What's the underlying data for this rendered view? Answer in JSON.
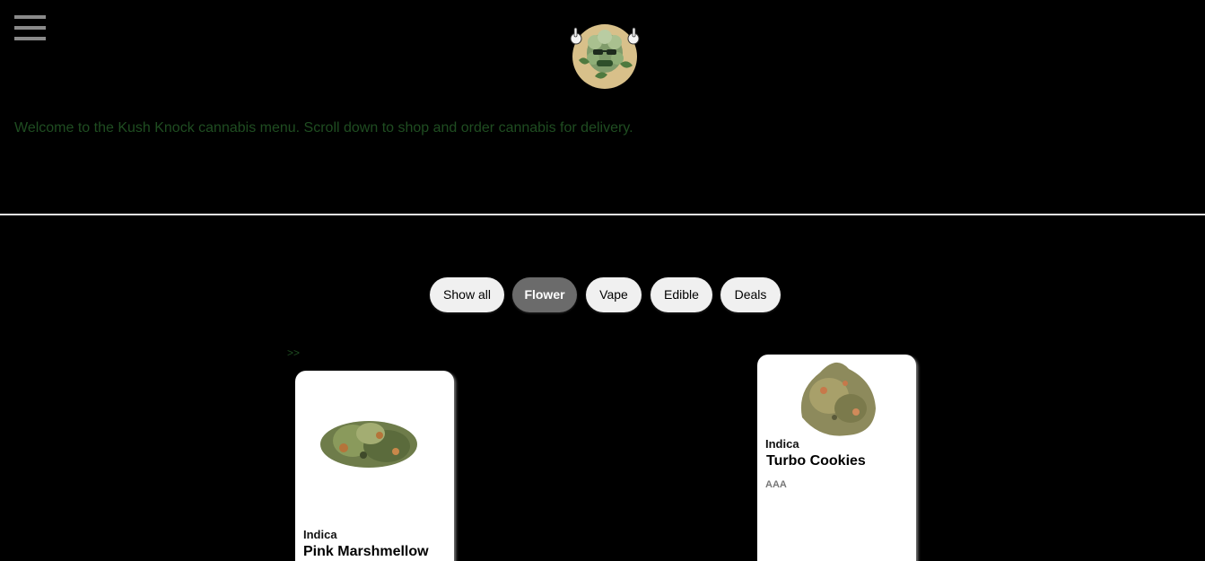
{
  "header": {
    "menu_icon": "hamburger-menu-icon",
    "logo": "kush-knock-logo"
  },
  "welcome_text": "Welcome to the Kush Knock cannabis menu. Scroll down to shop and order cannabis for delivery.",
  "filters": {
    "show_all": "Show all",
    "flower": "Flower",
    "vape": "Vape",
    "edible": "Edible",
    "deals": "Deals",
    "active": "Flower"
  },
  "scroll_arrow": ">>",
  "products": [
    {
      "strain_type": "Indica",
      "name": "Pink Marshmellow",
      "grade": ""
    },
    {
      "strain_type": "Indica",
      "name": "Turbo Cookies",
      "grade": "AAA"
    }
  ],
  "colors": {
    "background": "#000000",
    "welcome_text": "#1f4d21",
    "filter_bg": "#f0f0f0",
    "filter_active_bg": "#6b6b6b",
    "card_bg": "#ffffff"
  }
}
